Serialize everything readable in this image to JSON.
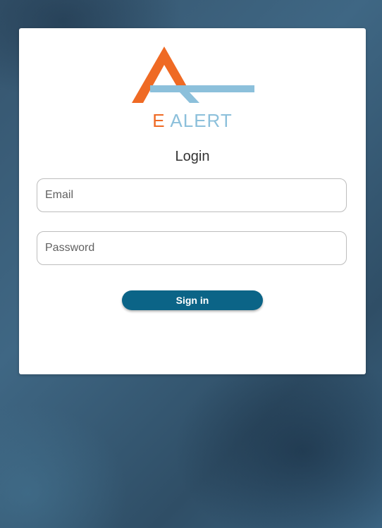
{
  "logo": {
    "letter": "E",
    "word": "ALERT",
    "primary_color": "#ef6a24",
    "secondary_color": "#8cc0db"
  },
  "form": {
    "title": "Login",
    "email_placeholder": "Email",
    "password_placeholder": "Password",
    "signin_label": "Sign in",
    "button_color": "#0b6487"
  }
}
